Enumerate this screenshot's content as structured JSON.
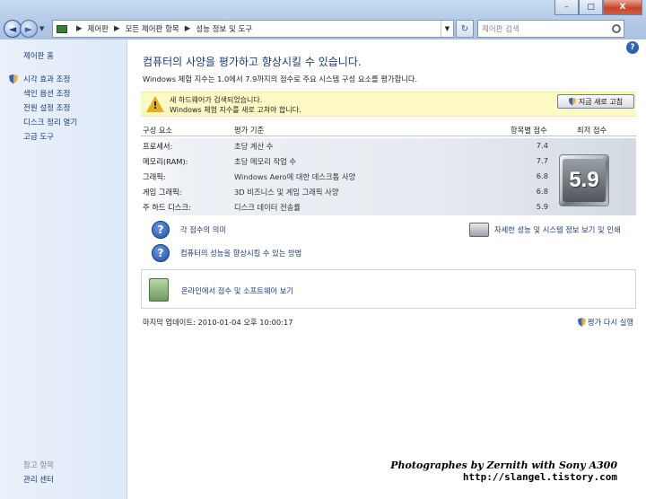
{
  "window": {
    "minimize": "–",
    "maximize": "□",
    "close": "X"
  },
  "nav": {
    "back": "◄",
    "forward": "►",
    "dropdown": "▼",
    "breadcrumbs": [
      "제어판",
      "모든 제어판 항목",
      "성능 정보 및 도구"
    ],
    "separator": "▶",
    "refresh": "↻",
    "search_placeholder": "제어판 검색"
  },
  "help": "?",
  "sidebar": {
    "home": "제어판 홈",
    "links": [
      {
        "label": "시각 효과 조정",
        "shield": true
      },
      {
        "label": "색인 옵션 조정",
        "shield": false
      },
      {
        "label": "전원 설정 조정",
        "shield": false
      },
      {
        "label": "디스크 정리 열기",
        "shield": false
      },
      {
        "label": "고급 도구",
        "shield": false
      }
    ],
    "see_also": "참고 항목",
    "action_center": "관리 센터"
  },
  "main": {
    "heading": "컴퓨터의 사양을 평가하고 향상시킬 수 있습니다.",
    "subtext": "Windows 체험 지수는 1.0에서 7.9까지의 점수로 주요 시스템 구성 요소를 평가합니다.",
    "alert": {
      "line1": "새 하드웨어가 검색되었습니다.",
      "line2": "Windows 체험 지수를 새로 고쳐야 합니다.",
      "button": "지금 새로 고침"
    },
    "table": {
      "headers": [
        "구성 요소",
        "평가 기준",
        "항목별 점수",
        "최저 점수"
      ],
      "rows": [
        {
          "component": "프로세서:",
          "criteria": "초당 계산 수",
          "score": "7.4"
        },
        {
          "component": "메모리(RAM):",
          "criteria": "초당 메모리 작업 수",
          "score": "7.7"
        },
        {
          "component": "그래픽:",
          "criteria": "Windows Aero에 대한 데스크톱 사양",
          "score": "6.8"
        },
        {
          "component": "게임 그래픽:",
          "criteria": "3D 비즈니스 및 게임 그래픽 사양",
          "score": "6.8"
        },
        {
          "component": "주 하드 디스크:",
          "criteria": "디스크 데이터 전송률",
          "score": "5.9"
        }
      ],
      "base_score": "5.9"
    },
    "links": {
      "score_meaning": "각 점수의 의미",
      "improve": "컴퓨터의 성능을 향상시킬 수 있는 방법",
      "details": "자세한 성능 및 시스템 정보 보기 및 인쇄",
      "online": "온라인에서 점수 및 소프트웨어 보기"
    },
    "last_update": "마지막 업데이트: 2010-01-04 오후 10:00:17",
    "rerun": "평가 다시 실행"
  },
  "watermark": {
    "line1": "Photographes by Zernith with Sony A300",
    "line2": "http://slangel.tistory.com"
  }
}
